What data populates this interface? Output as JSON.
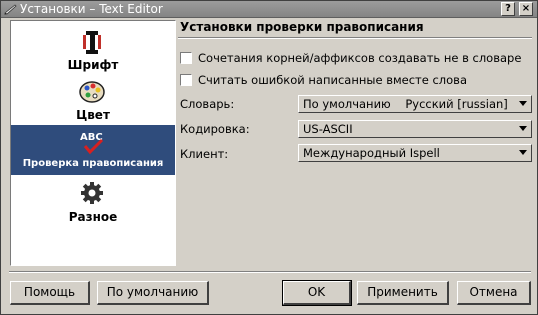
{
  "window": {
    "title": "Установки – Text Editor",
    "help_button": "?",
    "close_button": "×"
  },
  "sidebar": {
    "items": [
      {
        "label": "Шрифт",
        "icon": "font-icon"
      },
      {
        "label": "Цвет",
        "icon": "palette-icon"
      },
      {
        "label": "Проверка правописания",
        "icon": "spellcheck-icon",
        "selected": true
      },
      {
        "label": "Разное",
        "icon": "gear-icon"
      }
    ]
  },
  "main": {
    "section_title": "Установки проверки правописания",
    "check_roots": {
      "label": "Сочетания корней/аффиксов создавать не в словаре",
      "checked": false
    },
    "check_joined": {
      "label": "Считать ошибкой написанные вместе слова",
      "checked": false
    },
    "dictionary": {
      "label": "Словарь:",
      "value": "По умолчанию    Русский [russian]"
    },
    "encoding": {
      "label": "Кодировка:",
      "value": "US-ASCII"
    },
    "client": {
      "label": "Клиент:",
      "value": "Международный Ispell"
    }
  },
  "buttons": {
    "help": "Помощь",
    "defaults": "По умолчанию",
    "ok": "OK",
    "apply": "Применить",
    "cancel": "Отмена"
  },
  "colors": {
    "selection": "#2f4c7c",
    "titlebar": "#8c8c8c",
    "face": "#d4d0c8"
  }
}
